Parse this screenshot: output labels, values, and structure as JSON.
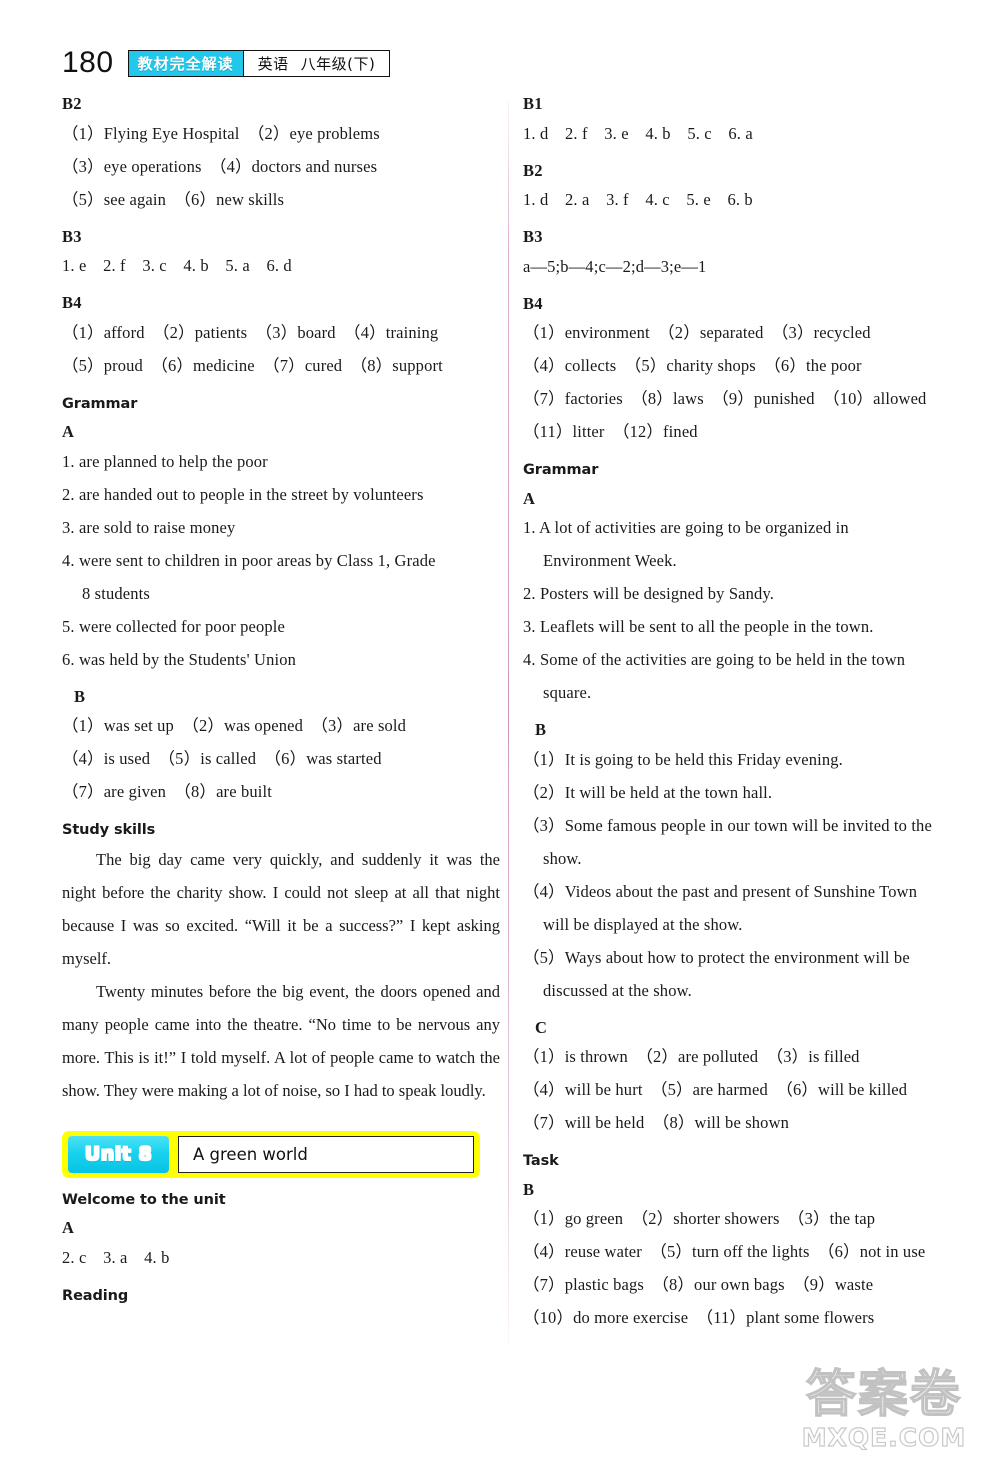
{
  "header": {
    "page_number": "180",
    "badge_label": "教材完全解读",
    "subject": "英语",
    "grade": "八年级(下)",
    "badge_color": "#22c7ec"
  },
  "left_column": {
    "sections": [
      {
        "heading": "B2",
        "style": "serif-bold"
      },
      {
        "text": "（1）Flying Eye Hospital　（2）eye problems"
      },
      {
        "text": "（3）eye operations　（4）doctors and nurses"
      },
      {
        "text": "（5）see again　（6）new skills"
      },
      {
        "heading": "B3",
        "style": "serif-bold"
      },
      {
        "text": "1. e　2. f　3. c　4. b　5. a　6. d"
      },
      {
        "heading": "B4",
        "style": "serif-bold"
      },
      {
        "text": "（1）afford　（2）patients　（3）board　（4）training"
      },
      {
        "text": "（5）proud　（6）medicine　（7）cured　（8）support"
      },
      {
        "heading": "Grammar",
        "style": "sans-bold"
      },
      {
        "heading": "A",
        "style": "serif-bold"
      },
      {
        "text": "1. are planned to help the poor"
      },
      {
        "text": "2. are handed out to people in the street by volunteers"
      },
      {
        "text": "3. are sold to raise money"
      },
      {
        "text": "4. were sent to children in poor areas by Class 1, Grade"
      },
      {
        "text": "8 students",
        "indent": true
      },
      {
        "text": "5. were collected for poor people"
      },
      {
        "text": "6. was held by the Students' Union"
      },
      {
        "heading": "B",
        "style": "serif-bold-indent"
      },
      {
        "text": "（1）was set up　（2）was opened　（3）are sold"
      },
      {
        "text": "（4）is used　（5）is called　（6）was started"
      },
      {
        "text": "（7）are given　（8）are built"
      },
      {
        "heading": "Study skills",
        "style": "sans-bold"
      }
    ],
    "study_skills_paragraphs": [
      "The big day came very quickly, and suddenly it was the night before the charity show. I could not sleep at all that night because I was so excited. “Will it be a success?” I kept asking myself.",
      "Twenty minutes before the big event, the doors opened and many people came into the theatre. “No time to be nervous any more. This is it!” I told myself. A lot of people came to watch the show. They were making a lot of noise, so I had to speak loudly."
    ],
    "unit_banner": {
      "unit_label": "Unit 8",
      "unit_title": "A green world",
      "banner_bg": "#ffff00",
      "chip_color": "#19d2ee"
    },
    "after_banner": [
      {
        "heading": "Welcome to the unit",
        "style": "sans-bold"
      },
      {
        "heading": "A",
        "style": "serif-bold"
      },
      {
        "text": "2. c　3. a　4. b"
      },
      {
        "heading": "Reading",
        "style": "sans-bold"
      }
    ]
  },
  "right_column": {
    "sections": [
      {
        "heading": "B1",
        "style": "serif-bold"
      },
      {
        "text": "1. d　2. f　3. e　4. b　5. c　6. a"
      },
      {
        "heading": "B2",
        "style": "serif-bold"
      },
      {
        "text": "1. d　2. a　3. f　4. c　5. e　6. b"
      },
      {
        "heading": "B3",
        "style": "serif-bold"
      },
      {
        "text": "a—5;b—4;c—2;d—3;e—1"
      },
      {
        "heading": "B4",
        "style": "serif-bold"
      },
      {
        "text": "（1）environment　（2）separated　（3）recycled"
      },
      {
        "text": "（4）collects　（5）charity shops　（6）the poor"
      },
      {
        "text": "（7）factories　（8）laws　（9）punished　（10）allowed"
      },
      {
        "text": "（11）litter　（12）fined"
      },
      {
        "heading": "Grammar",
        "style": "sans-bold"
      },
      {
        "heading": "A",
        "style": "serif-bold"
      },
      {
        "text": "1. A lot of activities are going to be organized in",
        "justify": true
      },
      {
        "text": "Environment Week.",
        "indent": true
      },
      {
        "text": "2. Posters will be designed by Sandy."
      },
      {
        "text": "3. Leaflets will be sent to all the people in the town."
      },
      {
        "text": "4. Some of the activities are going to be held in the town",
        "justify": true
      },
      {
        "text": "square.",
        "indent": true
      },
      {
        "heading": "B",
        "style": "serif-bold-indent"
      },
      {
        "text": "（1）It is going to be held this Friday evening."
      },
      {
        "text": "（2）It will be held at the town hall."
      },
      {
        "text": "（3）Some famous people in our town will be invited to the",
        "justify": true
      },
      {
        "text": "show.",
        "indent": true
      },
      {
        "text": "（4）Videos about the past and present of Sunshine Town",
        "justify": true
      },
      {
        "text": "will be displayed at the show.",
        "indent": true
      },
      {
        "text": "（5）Ways about how to protect the environment will be",
        "justify": true
      },
      {
        "text": "discussed at the show.",
        "indent": true
      },
      {
        "heading": "C",
        "style": "serif-bold-indent"
      },
      {
        "text": "（1）is thrown　（2）are polluted　（3）is filled"
      },
      {
        "text": "（4）will be hurt　（5）are harmed　（6）will be killed"
      },
      {
        "text": "（7）will be held　（8）will be shown"
      },
      {
        "heading": "Task",
        "style": "sans-bold"
      },
      {
        "heading": "B",
        "style": "serif-bold"
      },
      {
        "text": "（1）go green　（2）shorter showers　（3）the tap"
      },
      {
        "text": "（4）reuse water　（5）turn off the lights　（6）not in use"
      },
      {
        "text": "（7）plastic bags　（8）our own bags　（9）waste"
      },
      {
        "text": "（10）do more exercise　（11）plant some flowers"
      }
    ]
  },
  "watermark": {
    "cn_text": "答案卷",
    "en_text": "MXQE.COM"
  }
}
